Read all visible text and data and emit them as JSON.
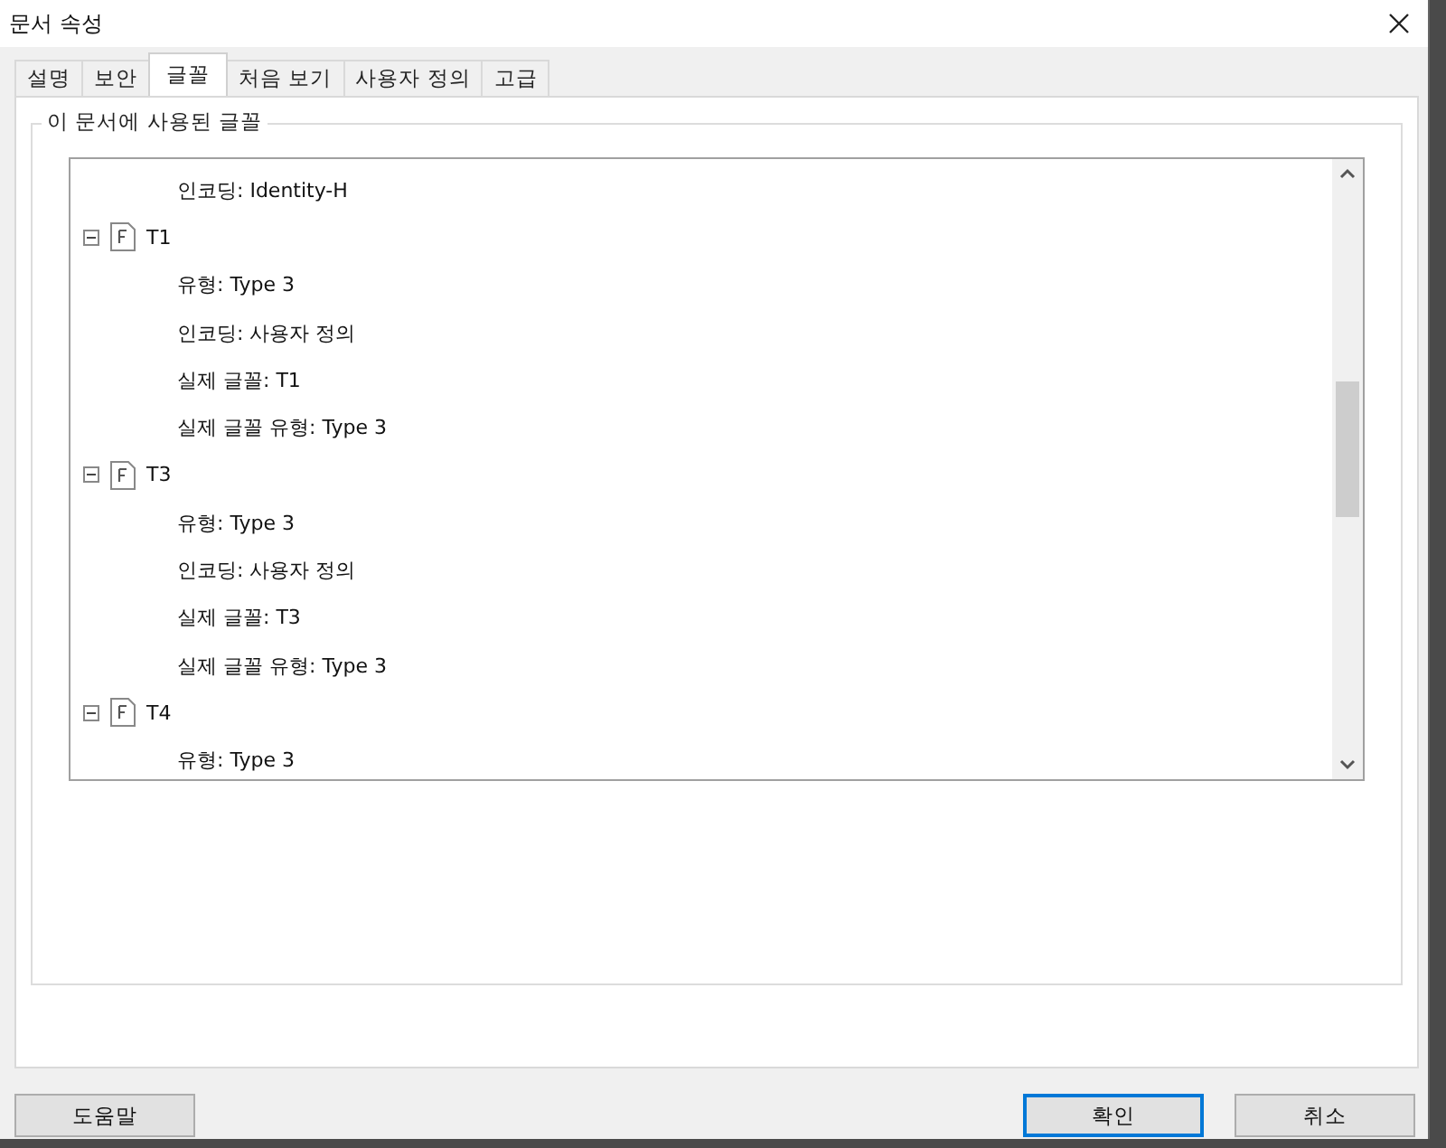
{
  "window": {
    "title": "문서 속성"
  },
  "tabs": [
    {
      "label": "설명",
      "selected": false
    },
    {
      "label": "보안",
      "selected": false
    },
    {
      "label": "글꼴",
      "selected": true
    },
    {
      "label": "처음 보기",
      "selected": false
    },
    {
      "label": "사용자 정의",
      "selected": false
    },
    {
      "label": "고급",
      "selected": false
    }
  ],
  "group": {
    "title": "이 문서에 사용된 글꼴"
  },
  "tree": [
    {
      "kind": "property",
      "label": "인코딩: Identity-H"
    },
    {
      "kind": "font",
      "label": "T1",
      "expanded": true,
      "children": [
        {
          "kind": "property",
          "label": "유형: Type 3"
        },
        {
          "kind": "property",
          "label": "인코딩: 사용자 정의"
        },
        {
          "kind": "property",
          "label": "실제 글꼴: T1"
        },
        {
          "kind": "property",
          "label": "실제 글꼴 유형: Type 3"
        }
      ]
    },
    {
      "kind": "font",
      "label": "T3",
      "expanded": true,
      "children": [
        {
          "kind": "property",
          "label": "유형: Type 3"
        },
        {
          "kind": "property",
          "label": "인코딩: 사용자 정의"
        },
        {
          "kind": "property",
          "label": "실제 글꼴: T3"
        },
        {
          "kind": "property",
          "label": "실제 글꼴 유형: Type 3"
        }
      ]
    },
    {
      "kind": "font",
      "label": "T4",
      "expanded": true,
      "children": [
        {
          "kind": "property",
          "label": "유형: Type 3"
        }
      ]
    }
  ],
  "buttons": [
    {
      "label": "도움말",
      "default": false
    },
    {
      "label": "확인",
      "default": true
    },
    {
      "label": "취소",
      "default": false
    }
  ]
}
